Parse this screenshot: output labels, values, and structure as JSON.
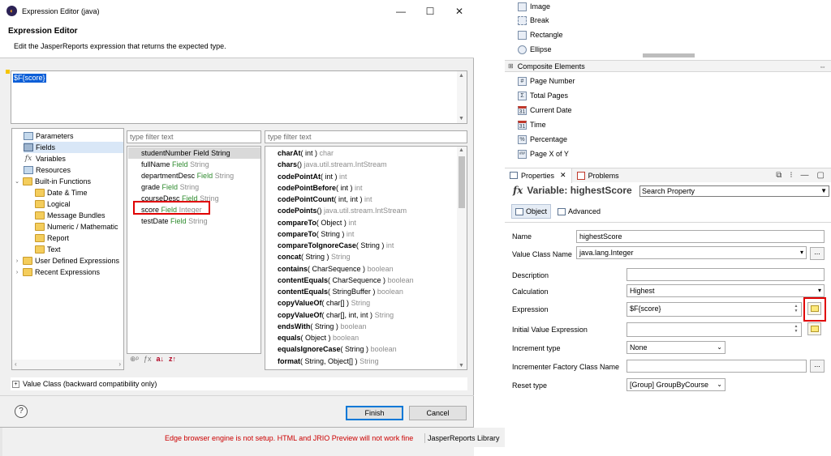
{
  "palette": {
    "items": [
      {
        "label": "Image",
        "icon": "image-icon"
      },
      {
        "label": "Break",
        "icon": "break-icon"
      },
      {
        "label": "Rectangle",
        "icon": "rectangle-icon"
      },
      {
        "label": "Ellipse",
        "icon": "ellipse-icon"
      }
    ],
    "composite_header": "Composite Elements",
    "composite_items": [
      {
        "label": "Page Number",
        "glyph": "#"
      },
      {
        "label": "Total Pages",
        "glyph": "Σ"
      },
      {
        "label": "Current Date",
        "glyph": "31"
      },
      {
        "label": "Time",
        "glyph": "31"
      },
      {
        "label": "Percentage",
        "glyph": "%"
      },
      {
        "label": "Page X of Y",
        "glyph": "#/#"
      }
    ]
  },
  "properties": {
    "tab_properties": "Properties",
    "tab_problems": "Problems",
    "title": "Variable: highestScore",
    "search_placeholder": "Search Property",
    "tab_object": "Object",
    "tab_advanced": "Advanced",
    "rows": {
      "name_label": "Name",
      "name_value": "highestScore",
      "value_class_label": "Value Class Name",
      "value_class_value": "java.lang.Integer",
      "description_label": "Description",
      "calculation_label": "Calculation",
      "calculation_value": "Highest",
      "expression_label": "Expression",
      "expression_value": "$F{score}",
      "initial_value_label": "Initial Value Expression",
      "increment_type_label": "Increment type",
      "increment_type_value": "None",
      "incrementer_label": "Incrementer Factory Class Name",
      "reset_type_label": "Reset type",
      "reset_type_value": "[Group] GroupByCourse"
    },
    "dots": "..."
  },
  "dialog": {
    "window_title": "Expression Editor (java)",
    "header_title": "Expression Editor",
    "header_desc": "Edit the JasperReports expression that returns the expected type.",
    "expression_text": "$F{score}",
    "tree": {
      "parameters": "Parameters",
      "fields": "Fields",
      "variables": "Variables",
      "resources": "Resources",
      "builtin": "Built-in Functions",
      "date_time": "Date & Time",
      "logical": "Logical",
      "message_bundles": "Message Bundles",
      "numeric": "Numeric / Mathematic",
      "report": "Report",
      "text": "Text",
      "user_defined": "User Defined Expressions",
      "recent": "Recent Expressions"
    },
    "filter_placeholder": "type filter text",
    "fields": [
      {
        "name": "studentNumber",
        "kind": "Field",
        "type": "String"
      },
      {
        "name": "fullName",
        "kind": "Field",
        "type": "String"
      },
      {
        "name": "departmentDesc",
        "kind": "Field",
        "type": "String"
      },
      {
        "name": "grade",
        "kind": "Field",
        "type": "String"
      },
      {
        "name": "courseDesc",
        "kind": "Field",
        "type": "String"
      },
      {
        "name": "score",
        "kind": "Field",
        "type": "Integer"
      },
      {
        "name": "testDate",
        "kind": "Field",
        "type": "String"
      }
    ],
    "methods": [
      {
        "name": "charAt",
        "args": "( int )",
        "ret": "char"
      },
      {
        "name": "chars",
        "args": "()",
        "ret": "java.util.stream.IntStream"
      },
      {
        "name": "codePointAt",
        "args": "( int )",
        "ret": "int"
      },
      {
        "name": "codePointBefore",
        "args": "( int )",
        "ret": "int"
      },
      {
        "name": "codePointCount",
        "args": "( int, int )",
        "ret": "int"
      },
      {
        "name": "codePoints",
        "args": "()",
        "ret": "java.util.stream.IntStream"
      },
      {
        "name": "compareTo",
        "args": "( Object )",
        "ret": "int"
      },
      {
        "name": "compareTo",
        "args": "( String )",
        "ret": "int"
      },
      {
        "name": "compareToIgnoreCase",
        "args": "( String )",
        "ret": "int"
      },
      {
        "name": "concat",
        "args": "( String )",
        "ret": "String"
      },
      {
        "name": "contains",
        "args": "( CharSequence )",
        "ret": "boolean"
      },
      {
        "name": "contentEquals",
        "args": "( CharSequence )",
        "ret": "boolean"
      },
      {
        "name": "contentEquals",
        "args": "( StringBuffer )",
        "ret": "boolean"
      },
      {
        "name": "copyValueOf",
        "args": "( char[] )",
        "ret": "String"
      },
      {
        "name": "copyValueOf",
        "args": "( char[], int, int )",
        "ret": "String"
      },
      {
        "name": "endsWith",
        "args": "( String )",
        "ret": "boolean"
      },
      {
        "name": "equals",
        "args": "( Object )",
        "ret": "boolean"
      },
      {
        "name": "equalsIgnoreCase",
        "args": "( String )",
        "ret": "boolean"
      },
      {
        "name": "format",
        "args": "( String, Object[] )",
        "ret": "String"
      }
    ],
    "value_class_label": "Value Class (backward compatibility only)",
    "finish_label": "Finish",
    "cancel_label": "Cancel",
    "help_label": "?"
  },
  "status": {
    "warning": "Edge browser engine is not setup. HTML and JRIO Preview will not work fine",
    "library": "JasperReports Library"
  },
  "colors": {
    "selection_blue": "#0b5ed7",
    "highlight_red": "#e00000",
    "field_type_green": "#2e8b2e",
    "warning_red": "#cc0000"
  }
}
